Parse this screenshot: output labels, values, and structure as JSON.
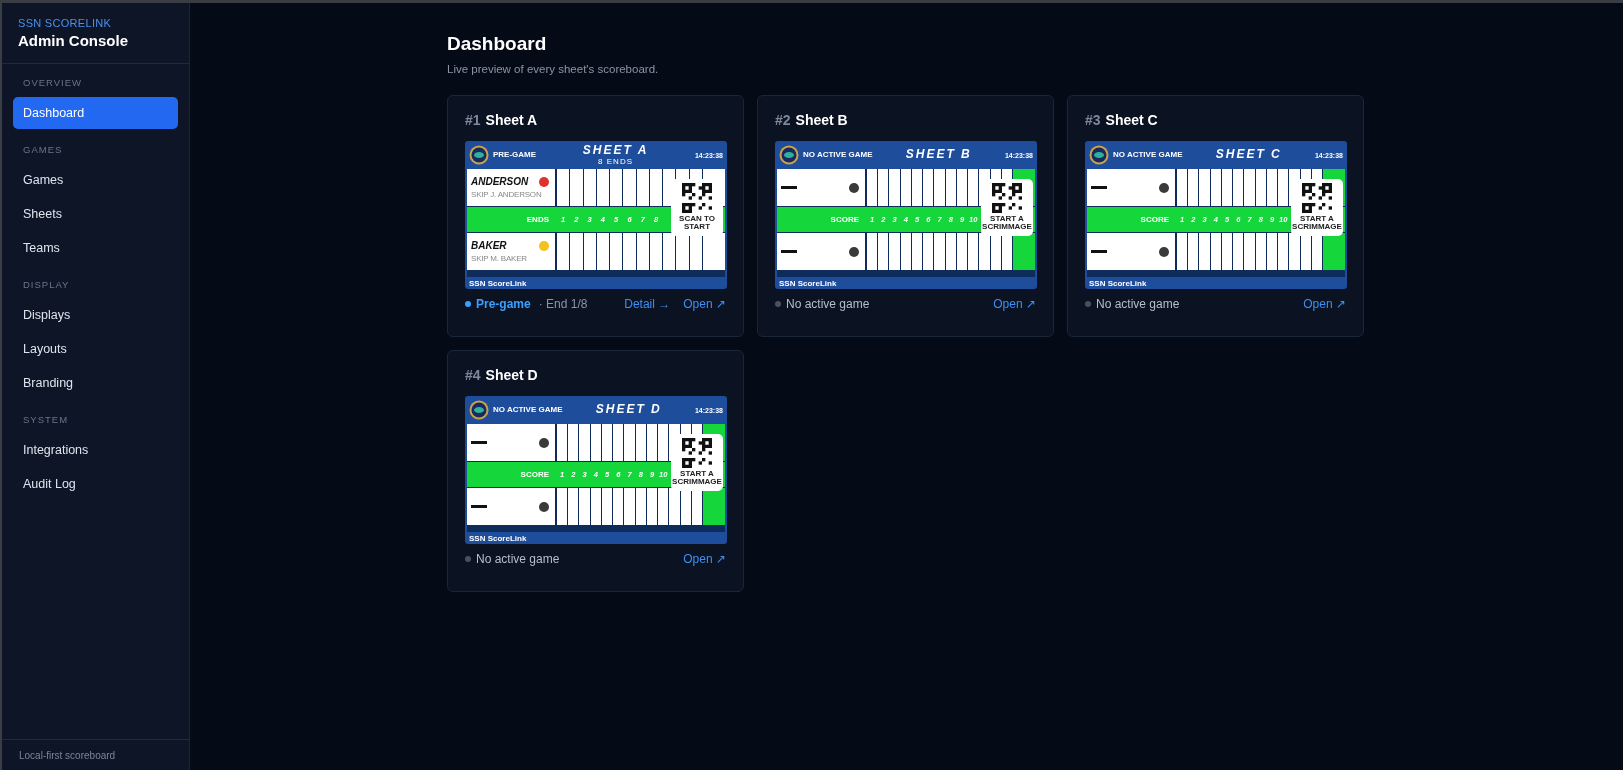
{
  "sidebar": {
    "brand": "SSN SCORELINK",
    "title": "Admin Console",
    "sections": [
      {
        "heading": "OVERVIEW",
        "items": [
          {
            "label": "Dashboard",
            "selected": true
          }
        ]
      },
      {
        "heading": "GAMES",
        "items": [
          {
            "label": "Games",
            "selected": false
          },
          {
            "label": "Sheets",
            "selected": false
          },
          {
            "label": "Teams",
            "selected": false
          }
        ]
      },
      {
        "heading": "DISPLAY",
        "items": [
          {
            "label": "Displays",
            "selected": false
          },
          {
            "label": "Layouts",
            "selected": false
          },
          {
            "label": "Branding",
            "selected": false
          }
        ]
      },
      {
        "heading": "SYSTEM",
        "items": [
          {
            "label": "Integrations",
            "selected": false
          },
          {
            "label": "Audit Log",
            "selected": false
          }
        ]
      }
    ],
    "footer": "Local-first scoreboard"
  },
  "page": {
    "title": "Dashboard",
    "subtitle": "Live preview of every sheet's scoreboard."
  },
  "sheets": [
    {
      "number": "#1",
      "name": "Sheet A",
      "board": {
        "status": "PRE-GAME",
        "title": "SHEET A",
        "subtitle": "8 ENDS",
        "time": "14:23:38",
        "row_label": "ENDS",
        "ends": [
          "1",
          "2",
          "3",
          "4",
          "5",
          "6",
          "7",
          "8"
        ],
        "total_green": false,
        "qr_caption": "SCAN TO START",
        "footer": "SSN ScoreLink",
        "teams": [
          {
            "name": "ANDERSON",
            "skip": "SKIP J. ANDERSON",
            "color": "#e0322c"
          },
          {
            "name": "BAKER",
            "skip": "SKIP M. BAKER",
            "color": "#f2c21b"
          }
        ]
      },
      "status": {
        "label": "Pre-game",
        "active": true,
        "detail": "· End 1/8"
      },
      "links": [
        "Detail →",
        "Open ↗"
      ]
    },
    {
      "number": "#2",
      "name": "Sheet B",
      "board": {
        "status": "NO ACTIVE GAME",
        "title": "SHEET B",
        "time": "14:23:38",
        "row_label": "SCORE",
        "ends": [
          "1",
          "2",
          "3",
          "4",
          "5",
          "6",
          "7",
          "8",
          "9",
          "10"
        ],
        "total_green": true,
        "qr_caption": "START A SCRIMMAGE",
        "footer": "SSN ScoreLink",
        "teams": [
          {
            "color": "#3a3a3a"
          },
          {
            "color": "#3a3a3a"
          }
        ]
      },
      "status": {
        "label": "No active game",
        "active": false
      },
      "links": [
        "Open ↗"
      ]
    },
    {
      "number": "#3",
      "name": "Sheet C",
      "board": {
        "status": "NO ACTIVE GAME",
        "title": "SHEET C",
        "time": "14:23:38",
        "row_label": "SCORE",
        "ends": [
          "1",
          "2",
          "3",
          "4",
          "5",
          "6",
          "7",
          "8",
          "9",
          "10"
        ],
        "total_green": true,
        "qr_caption": "START A SCRIMMAGE",
        "footer": "SSN ScoreLink",
        "teams": [
          {
            "color": "#3a3a3a"
          },
          {
            "color": "#3a3a3a"
          }
        ]
      },
      "status": {
        "label": "No active game",
        "active": false
      },
      "links": [
        "Open ↗"
      ]
    },
    {
      "number": "#4",
      "name": "Sheet D",
      "board": {
        "status": "NO ACTIVE GAME",
        "title": "SHEET D",
        "time": "14:23:38",
        "row_label": "SCORE",
        "ends": [
          "1",
          "2",
          "3",
          "4",
          "5",
          "6",
          "7",
          "8",
          "9",
          "10"
        ],
        "total_green": true,
        "qr_caption": "START A SCRIMMAGE",
        "footer": "SSN ScoreLink",
        "teams": [
          {
            "color": "#3a3a3a"
          },
          {
            "color": "#3a3a3a"
          }
        ]
      },
      "status": {
        "label": "No active game",
        "active": false
      },
      "links": [
        "Open ↗"
      ]
    }
  ]
}
